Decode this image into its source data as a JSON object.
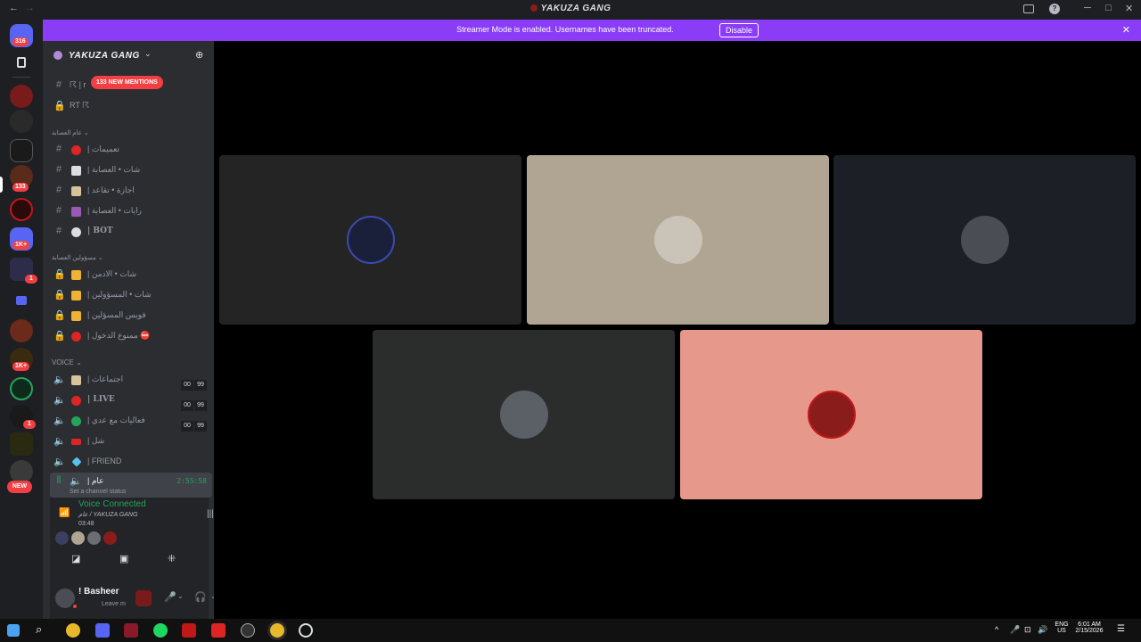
{
  "titlebar": {
    "back": "←",
    "forward": "→",
    "title": "YAKUZA GANG",
    "icons": [
      "screen-share-icon",
      "help-icon"
    ],
    "minimize": "─",
    "maximize": "□",
    "close": "✕"
  },
  "banner": {
    "message": "Streamer Mode is enabled. Usernames have been truncated.",
    "button": "Disable",
    "close": "✕"
  },
  "rail": {
    "badges": [
      {
        "label": "316"
      },
      {
        "label": "133"
      },
      {
        "label": "1K+"
      },
      {
        "label": "1"
      },
      {
        "label": "1K+"
      },
      {
        "label": "1"
      },
      {
        "label": "NEW"
      }
    ]
  },
  "sidebar": {
    "guild_name": "YAKUZA GANG",
    "new_mentions": "133 NEW MENTIONS",
    "channels_top": [
      {
        "symbol": "#",
        "label": "☈ | r"
      },
      {
        "symbol": "🔒",
        "label": "RT ☈"
      }
    ],
    "category1": "عام العصابة ⌄",
    "channels1": [
      {
        "symbol": "#",
        "label": "| تعميمات",
        "color": "#e02424"
      },
      {
        "symbol": "#",
        "label": "| شات • العصابة",
        "color": "#6d6f78"
      },
      {
        "symbol": "#",
        "label": "| اجازة • تقاعد",
        "color": "#d6c39a"
      },
      {
        "symbol": "#",
        "label": "| رايات • العصابة",
        "color": "#9b59b6"
      },
      {
        "symbol": "#",
        "label": "| BOT",
        "color": "#ffffff"
      }
    ],
    "category2": "مسؤولين العصابة ⌄",
    "channels2": [
      {
        "symbol": "🔒",
        "label": "| شات • الادمن",
        "color": "#f0b232"
      },
      {
        "symbol": "🔒",
        "label": "| شات • المسؤولين",
        "color": "#f0b232"
      },
      {
        "symbol": "🔒",
        "label": "| فويس المسؤلين",
        "color": "#f0b232"
      },
      {
        "symbol": "🔒",
        "label": "| ممنوع الدخول ⛔",
        "color": "#e02424"
      }
    ],
    "voice_category": "VOICE ⌄",
    "voice_channels": [
      {
        "label": "| اجتماعات",
        "color": "#d6c39a",
        "count": [
          "00",
          "99"
        ]
      },
      {
        "label": "| LIVE",
        "color": "#e02424",
        "count": [
          "00",
          "99"
        ]
      },
      {
        "label": "| فعاليات مع عدي",
        "color": "#23a55a",
        "count": [
          "00",
          "99"
        ]
      },
      {
        "label": "| شل",
        "color": "#e02424",
        "count": []
      },
      {
        "label": "| FRIEND",
        "color": "#5bc0eb",
        "count": []
      }
    ],
    "active_voice": {
      "label": "| عام",
      "timer": "2:55:58",
      "status": "Set a channel status"
    }
  },
  "voice_panel": {
    "status": "Voice Connected",
    "channel": "عام / YAKUZA GANG",
    "time": "03:48"
  },
  "user": {
    "name": "! Basheer",
    "status": "Leave m"
  },
  "tiles_row1": [
    {
      "bg": "#242424",
      "avatar": "#1a1f3a"
    },
    {
      "bg": "#b0a592",
      "avatar": "#c9c3b8"
    },
    {
      "bg": "#1c1f26",
      "avatar": "#4a4d54"
    }
  ],
  "tiles_row2": [
    {
      "bg": "#2b2d2c",
      "avatar": "#5b5f66"
    },
    {
      "bg": "#e6998a",
      "avatar": "#8b1c1c"
    }
  ],
  "taskbar": {
    "lang": "ENG",
    "region": "US",
    "time": "6:01 AM",
    "date": "2/15/2026"
  }
}
